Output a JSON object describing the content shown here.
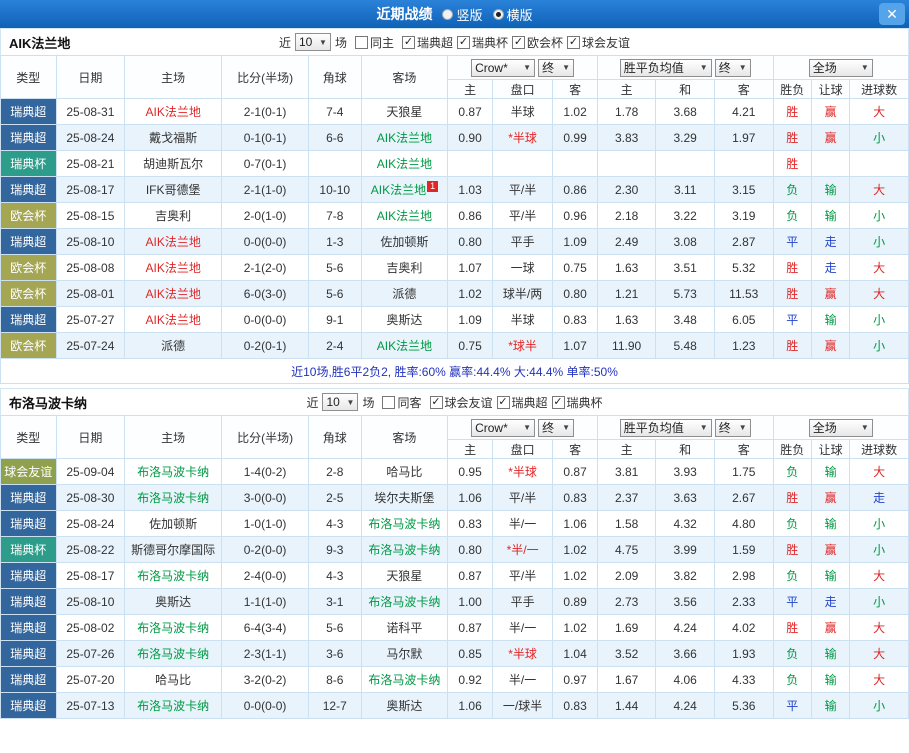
{
  "topbar": {
    "title": "近期战绩",
    "vertical_label": "竖版",
    "horizontal_label": "横版",
    "selected_layout": "横版",
    "close_glyph": "✕"
  },
  "filters": {
    "near": "近",
    "count": "10",
    "games": "场"
  },
  "header": {
    "type": "类型",
    "date": "日期",
    "home": "主场",
    "score": "比分(半场)",
    "corner": "角球",
    "away": "客场",
    "bookmaker": "Crow*",
    "end": "终",
    "avg": "胜平负均值",
    "full": "全场",
    "sub": [
      "主",
      "盘口",
      "客",
      "主",
      "和",
      "客",
      "胜负",
      "让球",
      "进球数"
    ]
  },
  "colors": {
    "league": {
      "瑞典超": "#33669c",
      "瑞典杯": "#2e9c8a",
      "欧会杯": "#a4a653",
      "球会友谊": "#8fa14d"
    },
    "team": {
      "red": "#e02626",
      "green": "#009944",
      "plain": "#333333"
    },
    "result": {
      "胜": "#e02626",
      "平": "#2244cc",
      "负": "#009944",
      "赢": "#e02626",
      "走": "#2244cc",
      "输": "#009944",
      "大": "#e02626",
      "小": "#009944"
    },
    "handicap_star": "#e02626",
    "handicap": "#333333"
  },
  "sections": [
    {
      "team": "AIK法兰地",
      "filter": {
        "same": "同主",
        "same_checked": false,
        "leagues": [
          {
            "label": "瑞典超",
            "checked": true
          },
          {
            "label": "瑞典杯",
            "checked": true
          },
          {
            "label": "欧会杯",
            "checked": true
          },
          {
            "label": "球会友谊",
            "checked": true
          }
        ]
      },
      "rows": [
        {
          "league": "瑞典超",
          "date": "25-08-31",
          "home": "AIK法兰地",
          "hs": "red",
          "score": "2-1(0-1)",
          "corner": "7-4",
          "away": "天狼星",
          "as": "plain",
          "odds": [
            "0.87",
            "半球",
            "1.02"
          ],
          "avg": [
            "1.78",
            "3.68",
            "4.21"
          ],
          "res": [
            "胜",
            "赢",
            "大"
          ]
        },
        {
          "league": "瑞典超",
          "date": "25-08-24",
          "home": "戴戈福斯",
          "hs": "plain",
          "score": "0-1(0-1)",
          "corner": "6-6",
          "away": "AIK法兰地",
          "as": "green",
          "odds": [
            "0.90",
            "*半球",
            "0.99"
          ],
          "avg": [
            "3.83",
            "3.29",
            "1.97"
          ],
          "res": [
            "胜",
            "赢",
            "小"
          ]
        },
        {
          "league": "瑞典杯",
          "date": "25-08-21",
          "home": "胡迪斯瓦尔",
          "hs": "plain",
          "score": "0-7(0-1)",
          "corner": "",
          "away": "AIK法兰地",
          "as": "green",
          "odds": [
            "",
            "",
            ""
          ],
          "avg": [
            "",
            "",
            ""
          ],
          "res": [
            "胜",
            "",
            ""
          ]
        },
        {
          "league": "瑞典超",
          "date": "25-08-17",
          "home": "IFK哥德堡",
          "hs": "plain",
          "score": "2-1(1-0)",
          "corner": "10-10",
          "away": "AIK法兰地",
          "as": "green",
          "ab": "1",
          "odds": [
            "1.03",
            "平/半",
            "0.86"
          ],
          "avg": [
            "2.30",
            "3.11",
            "3.15"
          ],
          "res": [
            "负",
            "输",
            "大"
          ]
        },
        {
          "league": "欧会杯",
          "date": "25-08-15",
          "home": "吉奥利",
          "hs": "plain",
          "score": "2-0(1-0)",
          "corner": "7-8",
          "away": "AIK法兰地",
          "as": "green",
          "odds": [
            "0.86",
            "平/半",
            "0.96"
          ],
          "avg": [
            "2.18",
            "3.22",
            "3.19"
          ],
          "res": [
            "负",
            "输",
            "小"
          ]
        },
        {
          "league": "瑞典超",
          "date": "25-08-10",
          "home": "AIK法兰地",
          "hs": "red",
          "score": "0-0(0-0)",
          "corner": "1-3",
          "away": "佐加顿斯",
          "as": "plain",
          "odds": [
            "0.80",
            "平手",
            "1.09"
          ],
          "avg": [
            "2.49",
            "3.08",
            "2.87"
          ],
          "res": [
            "平",
            "走",
            "小"
          ]
        },
        {
          "league": "欧会杯",
          "date": "25-08-08",
          "home": "AIK法兰地",
          "hs": "red",
          "score": "2-1(2-0)",
          "corner": "5-6",
          "away": "吉奥利",
          "as": "plain",
          "odds": [
            "1.07",
            "一球",
            "0.75"
          ],
          "avg": [
            "1.63",
            "3.51",
            "5.32"
          ],
          "res": [
            "胜",
            "走",
            "大"
          ]
        },
        {
          "league": "欧会杯",
          "date": "25-08-01",
          "home": "AIK法兰地",
          "hs": "red",
          "score": "6-0(3-0)",
          "corner": "5-6",
          "away": "派德",
          "as": "plain",
          "odds": [
            "1.02",
            "球半/两",
            "0.80"
          ],
          "avg": [
            "1.21",
            "5.73",
            "11.53"
          ],
          "res": [
            "胜",
            "赢",
            "大"
          ]
        },
        {
          "league": "瑞典超",
          "date": "25-07-27",
          "home": "AIK法兰地",
          "hs": "red",
          "score": "0-0(0-0)",
          "corner": "9-1",
          "away": "奥斯达",
          "as": "plain",
          "odds": [
            "1.09",
            "半球",
            "0.83"
          ],
          "avg": [
            "1.63",
            "3.48",
            "6.05"
          ],
          "res": [
            "平",
            "输",
            "小"
          ]
        },
        {
          "league": "欧会杯",
          "date": "25-07-24",
          "home": "派德",
          "hs": "plain",
          "score": "0-2(0-1)",
          "corner": "2-4",
          "away": "AIK法兰地",
          "as": "green",
          "odds": [
            "0.75",
            "*球半",
            "1.07"
          ],
          "avg": [
            "11.90",
            "5.48",
            "1.23"
          ],
          "res": [
            "胜",
            "赢",
            "小"
          ]
        }
      ],
      "summary": "近10场,胜6平2负2, 胜率:60% 赢率:44.4% 大:44.4% 单率:50%"
    },
    {
      "team": "布洛马波卡纳",
      "filter": {
        "same": "同客",
        "same_checked": false,
        "leagues": [
          {
            "label": "球会友谊",
            "checked": true
          },
          {
            "label": "瑞典超",
            "checked": true
          },
          {
            "label": "瑞典杯",
            "checked": true
          }
        ]
      },
      "rows": [
        {
          "league": "球会友谊",
          "date": "25-09-04",
          "home": "布洛马波卡纳",
          "hs": "green",
          "score": "1-4(0-2)",
          "corner": "2-8",
          "away": "哈马比",
          "as": "plain",
          "odds": [
            "0.95",
            "*半球",
            "0.87"
          ],
          "avg": [
            "3.81",
            "3.93",
            "1.75"
          ],
          "res": [
            "负",
            "输",
            "大"
          ]
        },
        {
          "league": "瑞典超",
          "date": "25-08-30",
          "home": "布洛马波卡纳",
          "hs": "green",
          "score": "3-0(0-0)",
          "corner": "2-5",
          "away": "埃尔夫斯堡",
          "as": "plain",
          "odds": [
            "1.06",
            "平/半",
            "0.83"
          ],
          "avg": [
            "2.37",
            "3.63",
            "2.67"
          ],
          "res": [
            "胜",
            "赢",
            "走"
          ]
        },
        {
          "league": "瑞典超",
          "date": "25-08-24",
          "home": "佐加顿斯",
          "hs": "plain",
          "score": "1-0(1-0)",
          "corner": "4-3",
          "away": "布洛马波卡纳",
          "as": "green",
          "odds": [
            "0.83",
            "半/一",
            "1.06"
          ],
          "avg": [
            "1.58",
            "4.32",
            "4.80"
          ],
          "res": [
            "负",
            "输",
            "小"
          ]
        },
        {
          "league": "瑞典杯",
          "date": "25-08-22",
          "home": "斯德哥尔摩国际",
          "hs": "plain",
          "score": "0-2(0-0)",
          "corner": "9-3",
          "away": "布洛马波卡纳",
          "as": "green",
          "odds": [
            "0.80",
            "*半/一",
            "1.02"
          ],
          "avg": [
            "4.75",
            "3.99",
            "1.59"
          ],
          "res": [
            "胜",
            "赢",
            "小"
          ]
        },
        {
          "league": "瑞典超",
          "date": "25-08-17",
          "home": "布洛马波卡纳",
          "hs": "green",
          "score": "2-4(0-0)",
          "corner": "4-3",
          "away": "天狼星",
          "as": "plain",
          "odds": [
            "0.87",
            "平/半",
            "1.02"
          ],
          "avg": [
            "2.09",
            "3.82",
            "2.98"
          ],
          "res": [
            "负",
            "输",
            "大"
          ]
        },
        {
          "league": "瑞典超",
          "date": "25-08-10",
          "home": "奥斯达",
          "hs": "plain",
          "score": "1-1(1-0)",
          "corner": "3-1",
          "away": "布洛马波卡纳",
          "as": "green",
          "odds": [
            "1.00",
            "平手",
            "0.89"
          ],
          "avg": [
            "2.73",
            "3.56",
            "2.33"
          ],
          "res": [
            "平",
            "走",
            "小"
          ]
        },
        {
          "league": "瑞典超",
          "date": "25-08-02",
          "home": "布洛马波卡纳",
          "hs": "green",
          "score": "6-4(3-4)",
          "corner": "5-6",
          "away": "诺科平",
          "as": "plain",
          "odds": [
            "0.87",
            "半/一",
            "1.02"
          ],
          "avg": [
            "1.69",
            "4.24",
            "4.02"
          ],
          "res": [
            "胜",
            "赢",
            "大"
          ]
        },
        {
          "league": "瑞典超",
          "date": "25-07-26",
          "home": "布洛马波卡纳",
          "hs": "green",
          "score": "2-3(1-1)",
          "corner": "3-6",
          "away": "马尔默",
          "as": "plain",
          "odds": [
            "0.85",
            "*半球",
            "1.04"
          ],
          "avg": [
            "3.52",
            "3.66",
            "1.93"
          ],
          "res": [
            "负",
            "输",
            "大"
          ]
        },
        {
          "league": "瑞典超",
          "date": "25-07-20",
          "home": "哈马比",
          "hs": "plain",
          "score": "3-2(0-2)",
          "corner": "8-6",
          "away": "布洛马波卡纳",
          "as": "green",
          "odds": [
            "0.92",
            "半/一",
            "0.97"
          ],
          "avg": [
            "1.67",
            "4.06",
            "4.33"
          ],
          "res": [
            "负",
            "输",
            "大"
          ]
        },
        {
          "league": "瑞典超",
          "date": "25-07-13",
          "home": "布洛马波卡纳",
          "hs": "green",
          "score": "0-0(0-0)",
          "corner": "12-7",
          "away": "奥斯达",
          "as": "plain",
          "odds": [
            "1.06",
            "一/球半",
            "0.83"
          ],
          "avg": [
            "1.44",
            "4.24",
            "5.36"
          ],
          "res": [
            "平",
            "输",
            "小"
          ]
        }
      ],
      "summary": null
    }
  ]
}
